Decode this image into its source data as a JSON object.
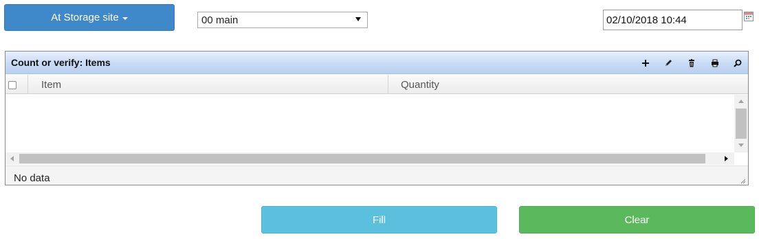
{
  "toolbar": {
    "site_button_label": "At Storage site",
    "warehouse_value": "00 main",
    "date_value": "02/10/2018 10:44"
  },
  "grid": {
    "title": "Count or verify: Items",
    "columns": [
      "Item",
      "Quantity"
    ],
    "rows": [],
    "footer": "No data",
    "tools": [
      "add-icon",
      "edit-icon",
      "delete-icon",
      "print-icon",
      "search-icon"
    ]
  },
  "actions": {
    "fill_label": "Fill",
    "clear_label": "Clear"
  },
  "colors": {
    "site_button": "#3f88c9",
    "fill_button": "#5bc0de",
    "clear_button": "#5cb85c"
  }
}
